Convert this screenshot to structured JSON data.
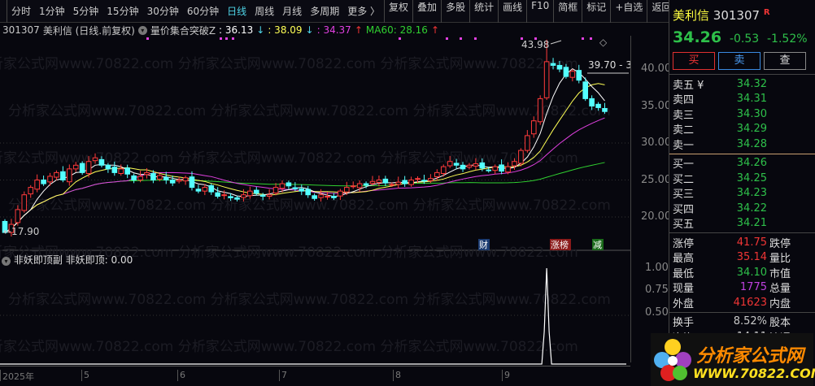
{
  "toolbar": {
    "items": [
      "分时",
      "1分钟",
      "5分钟",
      "15分钟",
      "30分钟",
      "60分钟",
      "日线",
      "周线",
      "月线",
      "多周期",
      "更多 〉"
    ],
    "active": "日线",
    "right_items": [
      "复权",
      "叠加",
      "多股",
      "统计",
      "画线",
      "F10",
      "简框",
      "标记",
      "+自选",
      "返回"
    ]
  },
  "info": {
    "code": "301307",
    "name": "美利信 (日线.前复权)",
    "indicator": "量价集合突破Z",
    "v1": ": 36.13",
    "v2": ": 38.09",
    "v3": ": 34.37",
    "ma60": "MA60: 28.16"
  },
  "chart_data": {
    "type": "candlestick",
    "x_months": [
      "2025年",
      "5",
      "6",
      "7",
      "8",
      "9"
    ],
    "ylim": [
      17,
      45
    ],
    "yticks": [
      "40.00",
      "35.00",
      "30.00",
      "25.00",
      "20.00"
    ],
    "closes": [
      17.9,
      19,
      21,
      23,
      24,
      25,
      24.5,
      25.5,
      26,
      25,
      26.5,
      27,
      26,
      27.5,
      28,
      27,
      26.5,
      26,
      26.5,
      25.8,
      25,
      25.5,
      26,
      25,
      25.6,
      25,
      24.6,
      25,
      25.3,
      24,
      23.5,
      24,
      23.4,
      22.8,
      23,
      22.6,
      22.4,
      23,
      23.5,
      23.2,
      22.8,
      23,
      24,
      24.5,
      24.2,
      23.8,
      23.5,
      23,
      22.5,
      23,
      22.8,
      22.6,
      23.5,
      24,
      24.2,
      24.5,
      24.3,
      24.8,
      25,
      24.6,
      24.4,
      24.7,
      24.5,
      25,
      25.2,
      24.9,
      25.2,
      26,
      26.8,
      27.5,
      27,
      26.5,
      27,
      27.2,
      26.6,
      26.3,
      26.8,
      26.2,
      26.8,
      27.5,
      29,
      31,
      33,
      36,
      41,
      40.5,
      40,
      39,
      39.7,
      38.5,
      36,
      35,
      34.79,
      34.26
    ],
    "annotations": {
      "high": "43.98",
      "low": "17.90",
      "last_range": "39.70 - 3"
    },
    "markers": [
      "财",
      "涨榜",
      "减"
    ]
  },
  "sub": {
    "title": "非妖即顶副",
    "label": "非妖即顶: 0.00",
    "yticks": [
      "1.00",
      "0.75",
      "0.50"
    ],
    "signal_index": 84,
    "signal_value": 1
  },
  "panel": {
    "name": "美利信",
    "code": "301307",
    "flag": "R",
    "price": "34.26",
    "change": "-0.53",
    "pct": "-1.52%",
    "buy": "买",
    "sell": "卖",
    "query": "查",
    "asks": [
      {
        "l": "卖五 ¥",
        "p": "34.32"
      },
      {
        "l": "卖四",
        "p": "34.31"
      },
      {
        "l": "卖三",
        "p": "34.30"
      },
      {
        "l": "卖二",
        "p": "34.29"
      },
      {
        "l": "卖一",
        "p": "34.28"
      }
    ],
    "bids": [
      {
        "l": "买一",
        "p": "34.26"
      },
      {
        "l": "买二",
        "p": "34.25"
      },
      {
        "l": "买三",
        "p": "34.23"
      },
      {
        "l": "买四",
        "p": "34.22"
      },
      {
        "l": "买五",
        "p": "34.21"
      }
    ],
    "stats": [
      {
        "l": "涨停",
        "v": "41.75",
        "c": "red",
        "r": "跌停"
      },
      {
        "l": "最高",
        "v": "35.14",
        "c": "red",
        "r": "量比"
      },
      {
        "l": "最低",
        "v": "34.10",
        "c": "green",
        "r": "市值"
      },
      {
        "l": "现量",
        "v": "1775",
        "c": "purple",
        "r": "总量"
      },
      {
        "l": "外盘",
        "v": "41623",
        "c": "red",
        "r": "内盘"
      }
    ],
    "stats2": [
      {
        "l": "换手",
        "v": "8.52%",
        "r": "股本"
      },
      {
        "l": "净资",
        "v": "14.11",
        "r": "流通"
      }
    ],
    "logo_text": "分析家公式网",
    "logo_url": "WWW.70822.COM"
  },
  "colors": {
    "up": "#ff3b3b",
    "down": "#54ffff",
    "ma5": "#ffffff",
    "ma10": "#ffff55",
    "ma20": "#e040e0",
    "ma60": "#30d030"
  }
}
